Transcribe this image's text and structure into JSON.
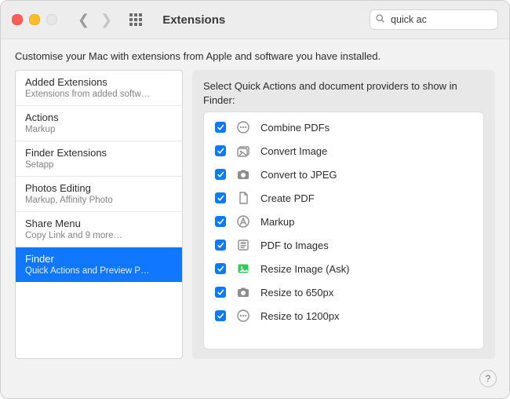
{
  "window": {
    "title": "Extensions",
    "subtitle": "Customise your Mac with extensions from Apple and software you have installed."
  },
  "search": {
    "value": "quick ac",
    "icon": "search-icon"
  },
  "sidebar": {
    "items": [
      {
        "title": "Added Extensions",
        "subtitle": "Extensions from added softw…",
        "selected": false
      },
      {
        "title": "Actions",
        "subtitle": "Markup",
        "selected": false
      },
      {
        "title": "Finder Extensions",
        "subtitle": "Setapp",
        "selected": false
      },
      {
        "title": "Photos Editing",
        "subtitle": "Markup, Affinity Photo",
        "selected": false
      },
      {
        "title": "Share Menu",
        "subtitle": "Copy Link and 9 more…",
        "selected": false
      },
      {
        "title": "Finder",
        "subtitle": "Quick Actions and Preview P…",
        "selected": true
      }
    ]
  },
  "content": {
    "header": "Select Quick Actions and document providers to show in Finder:",
    "actions": [
      {
        "checked": true,
        "icon": "dots-icon",
        "label": "Combine PDFs"
      },
      {
        "checked": true,
        "icon": "gallery-icon",
        "label": "Convert Image"
      },
      {
        "checked": true,
        "icon": "camera-icon",
        "label": "Convert to JPEG"
      },
      {
        "checked": true,
        "icon": "doc-icon",
        "label": "Create PDF"
      },
      {
        "checked": true,
        "icon": "markup-icon",
        "label": "Markup"
      },
      {
        "checked": true,
        "icon": "pdf-icon",
        "label": "PDF to Images"
      },
      {
        "checked": true,
        "icon": "image-icon",
        "label": "Resize Image (Ask)"
      },
      {
        "checked": true,
        "icon": "camera-icon",
        "label": "Resize to 650px"
      },
      {
        "checked": true,
        "icon": "dots-icon",
        "label": "Resize to 1200px"
      }
    ]
  },
  "colors": {
    "selection": "#0f78ff",
    "checkbox": "#0a7aff",
    "resize_icon": "#34c759"
  }
}
